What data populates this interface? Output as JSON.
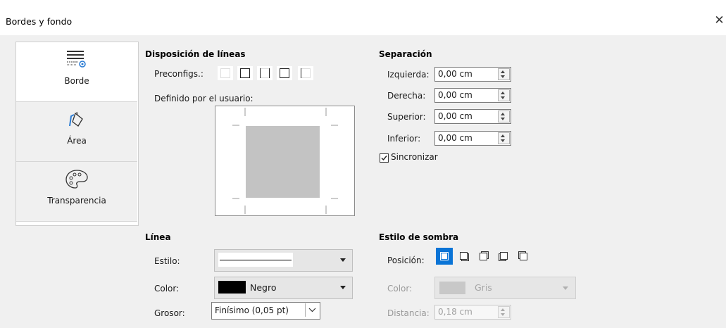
{
  "window": {
    "title": "Bordes y fondo",
    "close_glyph": "✕"
  },
  "sidebar": {
    "tabs": [
      {
        "label": "Borde",
        "icon": "borders-icon",
        "active": true
      },
      {
        "label": "Área",
        "icon": "area-bucket-icon",
        "active": false
      },
      {
        "label": "Transparencia",
        "icon": "palette-icon",
        "active": false
      }
    ]
  },
  "line_arrangement": {
    "heading": "Disposición de líneas",
    "presets_label": "Preconfigs.:",
    "presets": [
      "no-borders-icon",
      "outer-box-icon",
      "left-right-icon",
      "top-bottom-icon",
      "left-only-icon"
    ],
    "user_defined_label": "Definido por el usuario:"
  },
  "spacing": {
    "heading": "Separación",
    "fields": [
      {
        "label": "Izquierda:",
        "value": "0,00 cm"
      },
      {
        "label": "Derecha:",
        "value": "0,00 cm"
      },
      {
        "label": "Superior:",
        "value": "0,00 cm"
      },
      {
        "label": "Inferior:",
        "value": "0,00 cm"
      }
    ],
    "sync_label": "Sincronizar",
    "sync_checked": true
  },
  "line": {
    "heading": "Línea",
    "style_label": "Estilo:",
    "color_label": "Color:",
    "color_value": "Negro",
    "color_swatch": "#000000",
    "width_label": "Grosor:",
    "width_value": "Finísimo (0,05 pt)"
  },
  "shadow": {
    "heading": "Estilo de sombra",
    "position_label": "Posición:",
    "positions": [
      "no-shadow-icon",
      "shadow-bottom-right-icon",
      "shadow-top-right-icon",
      "shadow-bottom-left-icon",
      "shadow-top-left-icon"
    ],
    "color_label": "Color:",
    "color_value": "Gris",
    "color_swatch": "#c8c8c8",
    "distance_label": "Distancia:",
    "distance_value": "0,18 cm"
  },
  "colors": {
    "accent": "#0a74d6",
    "background": "#f0f0f0"
  }
}
